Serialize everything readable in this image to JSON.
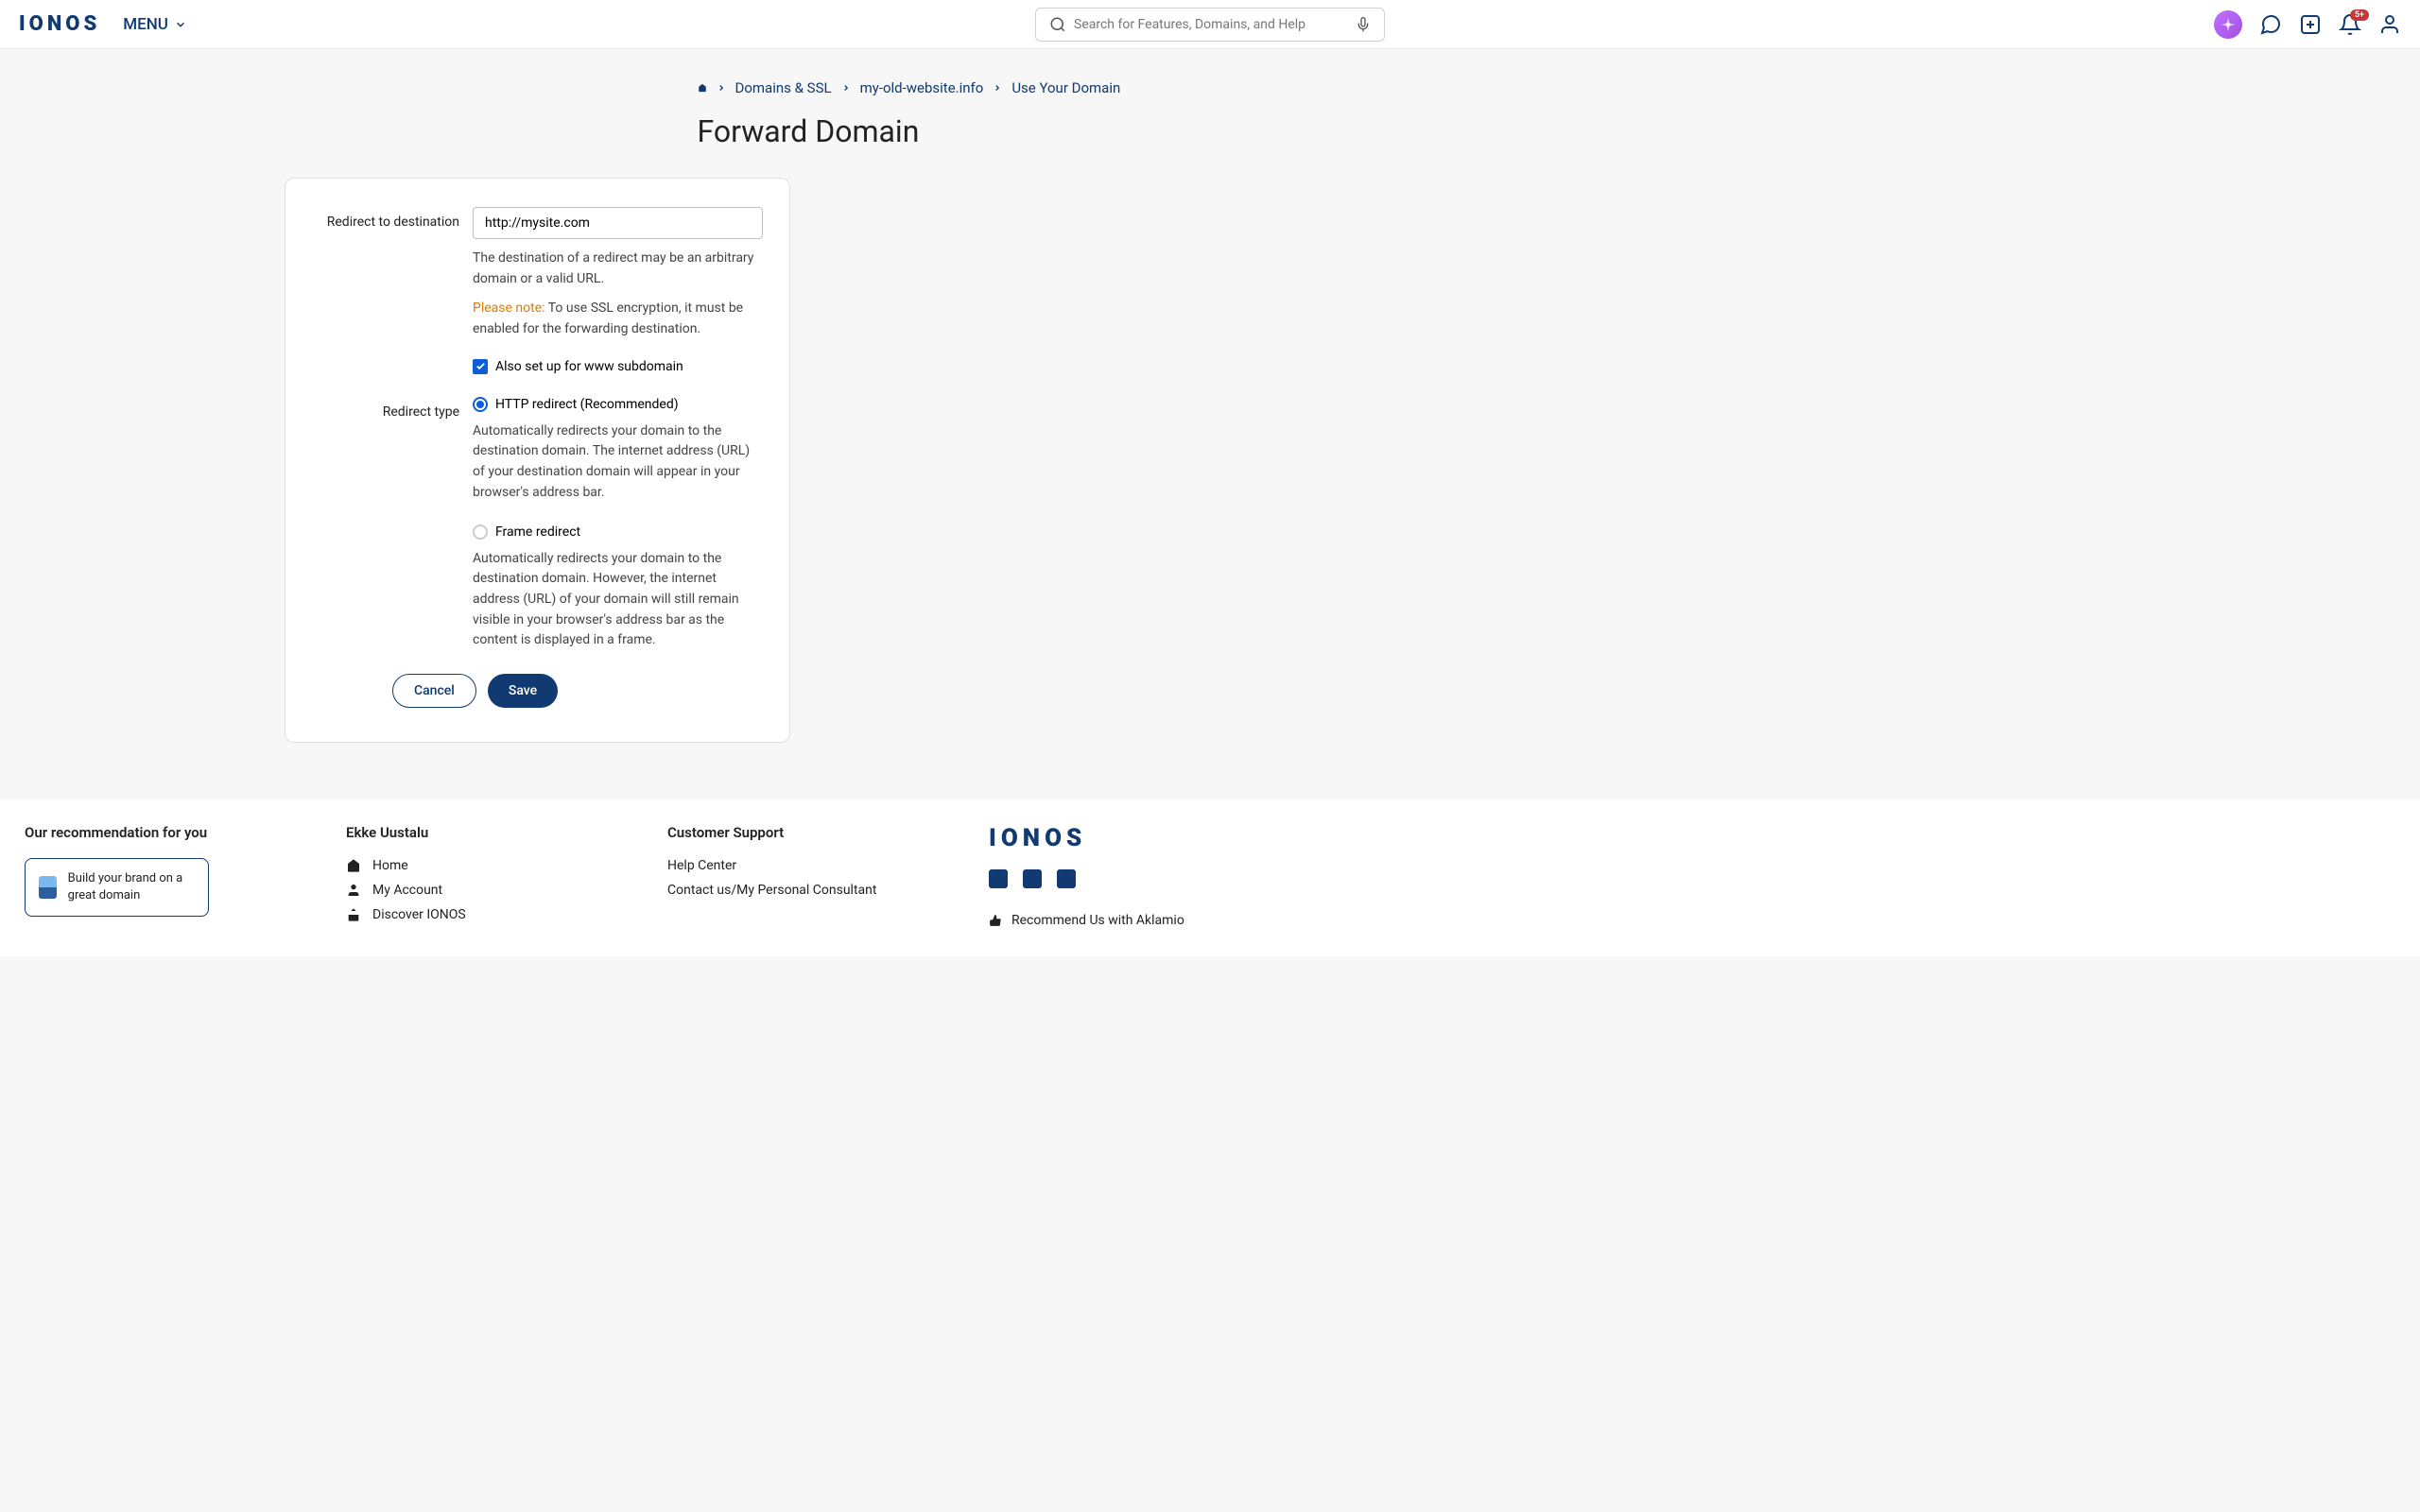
{
  "header": {
    "logo": "IONOS",
    "menu_label": "MENU",
    "search_placeholder": "Search for Features, Domains, and Help",
    "notification_count": "5+"
  },
  "breadcrumb": {
    "items": [
      {
        "label": "Domains & SSL"
      },
      {
        "label": "my-old-website.info"
      },
      {
        "label": "Use Your Domain"
      }
    ]
  },
  "page_title": "Forward Domain",
  "form": {
    "destination_label": "Redirect to destination",
    "destination_value": "http://mysite.com",
    "destination_help": "The destination of a redirect may be an arbitrary domain or a valid URL.",
    "note_prefix": "Please note:",
    "note_text": " To use SSL encryption, it must be enabled for the forwarding destination.",
    "www_checkbox_label": "Also set up for www subdomain",
    "redirect_type_label": "Redirect type",
    "http_redirect_label": "HTTP redirect (Recommended)",
    "http_redirect_description": "Automatically redirects your domain to the destination domain. The internet address (URL) of your destination domain will appear in your browser's address bar.",
    "frame_redirect_label": "Frame redirect",
    "frame_redirect_description": "Automatically redirects your domain to the destination domain. However, the internet address (URL) of your domain will still remain visible in your browser's address bar as the content is displayed in a frame.",
    "cancel_label": "Cancel",
    "save_label": "Save"
  },
  "footer": {
    "recommendation_heading": "Our recommendation for you",
    "recommendation_text": "Build your brand on a great domain",
    "user_heading": "Ekke Uustalu",
    "user_links": {
      "home": "Home",
      "account": "My Account",
      "discover": "Discover IONOS"
    },
    "support_heading": "Customer Support",
    "support_links": {
      "help": "Help Center",
      "contact": "Contact us/My Personal Consultant"
    },
    "footer_logo": "IONOS",
    "recommend_label": "Recommend Us with Aklamio"
  }
}
